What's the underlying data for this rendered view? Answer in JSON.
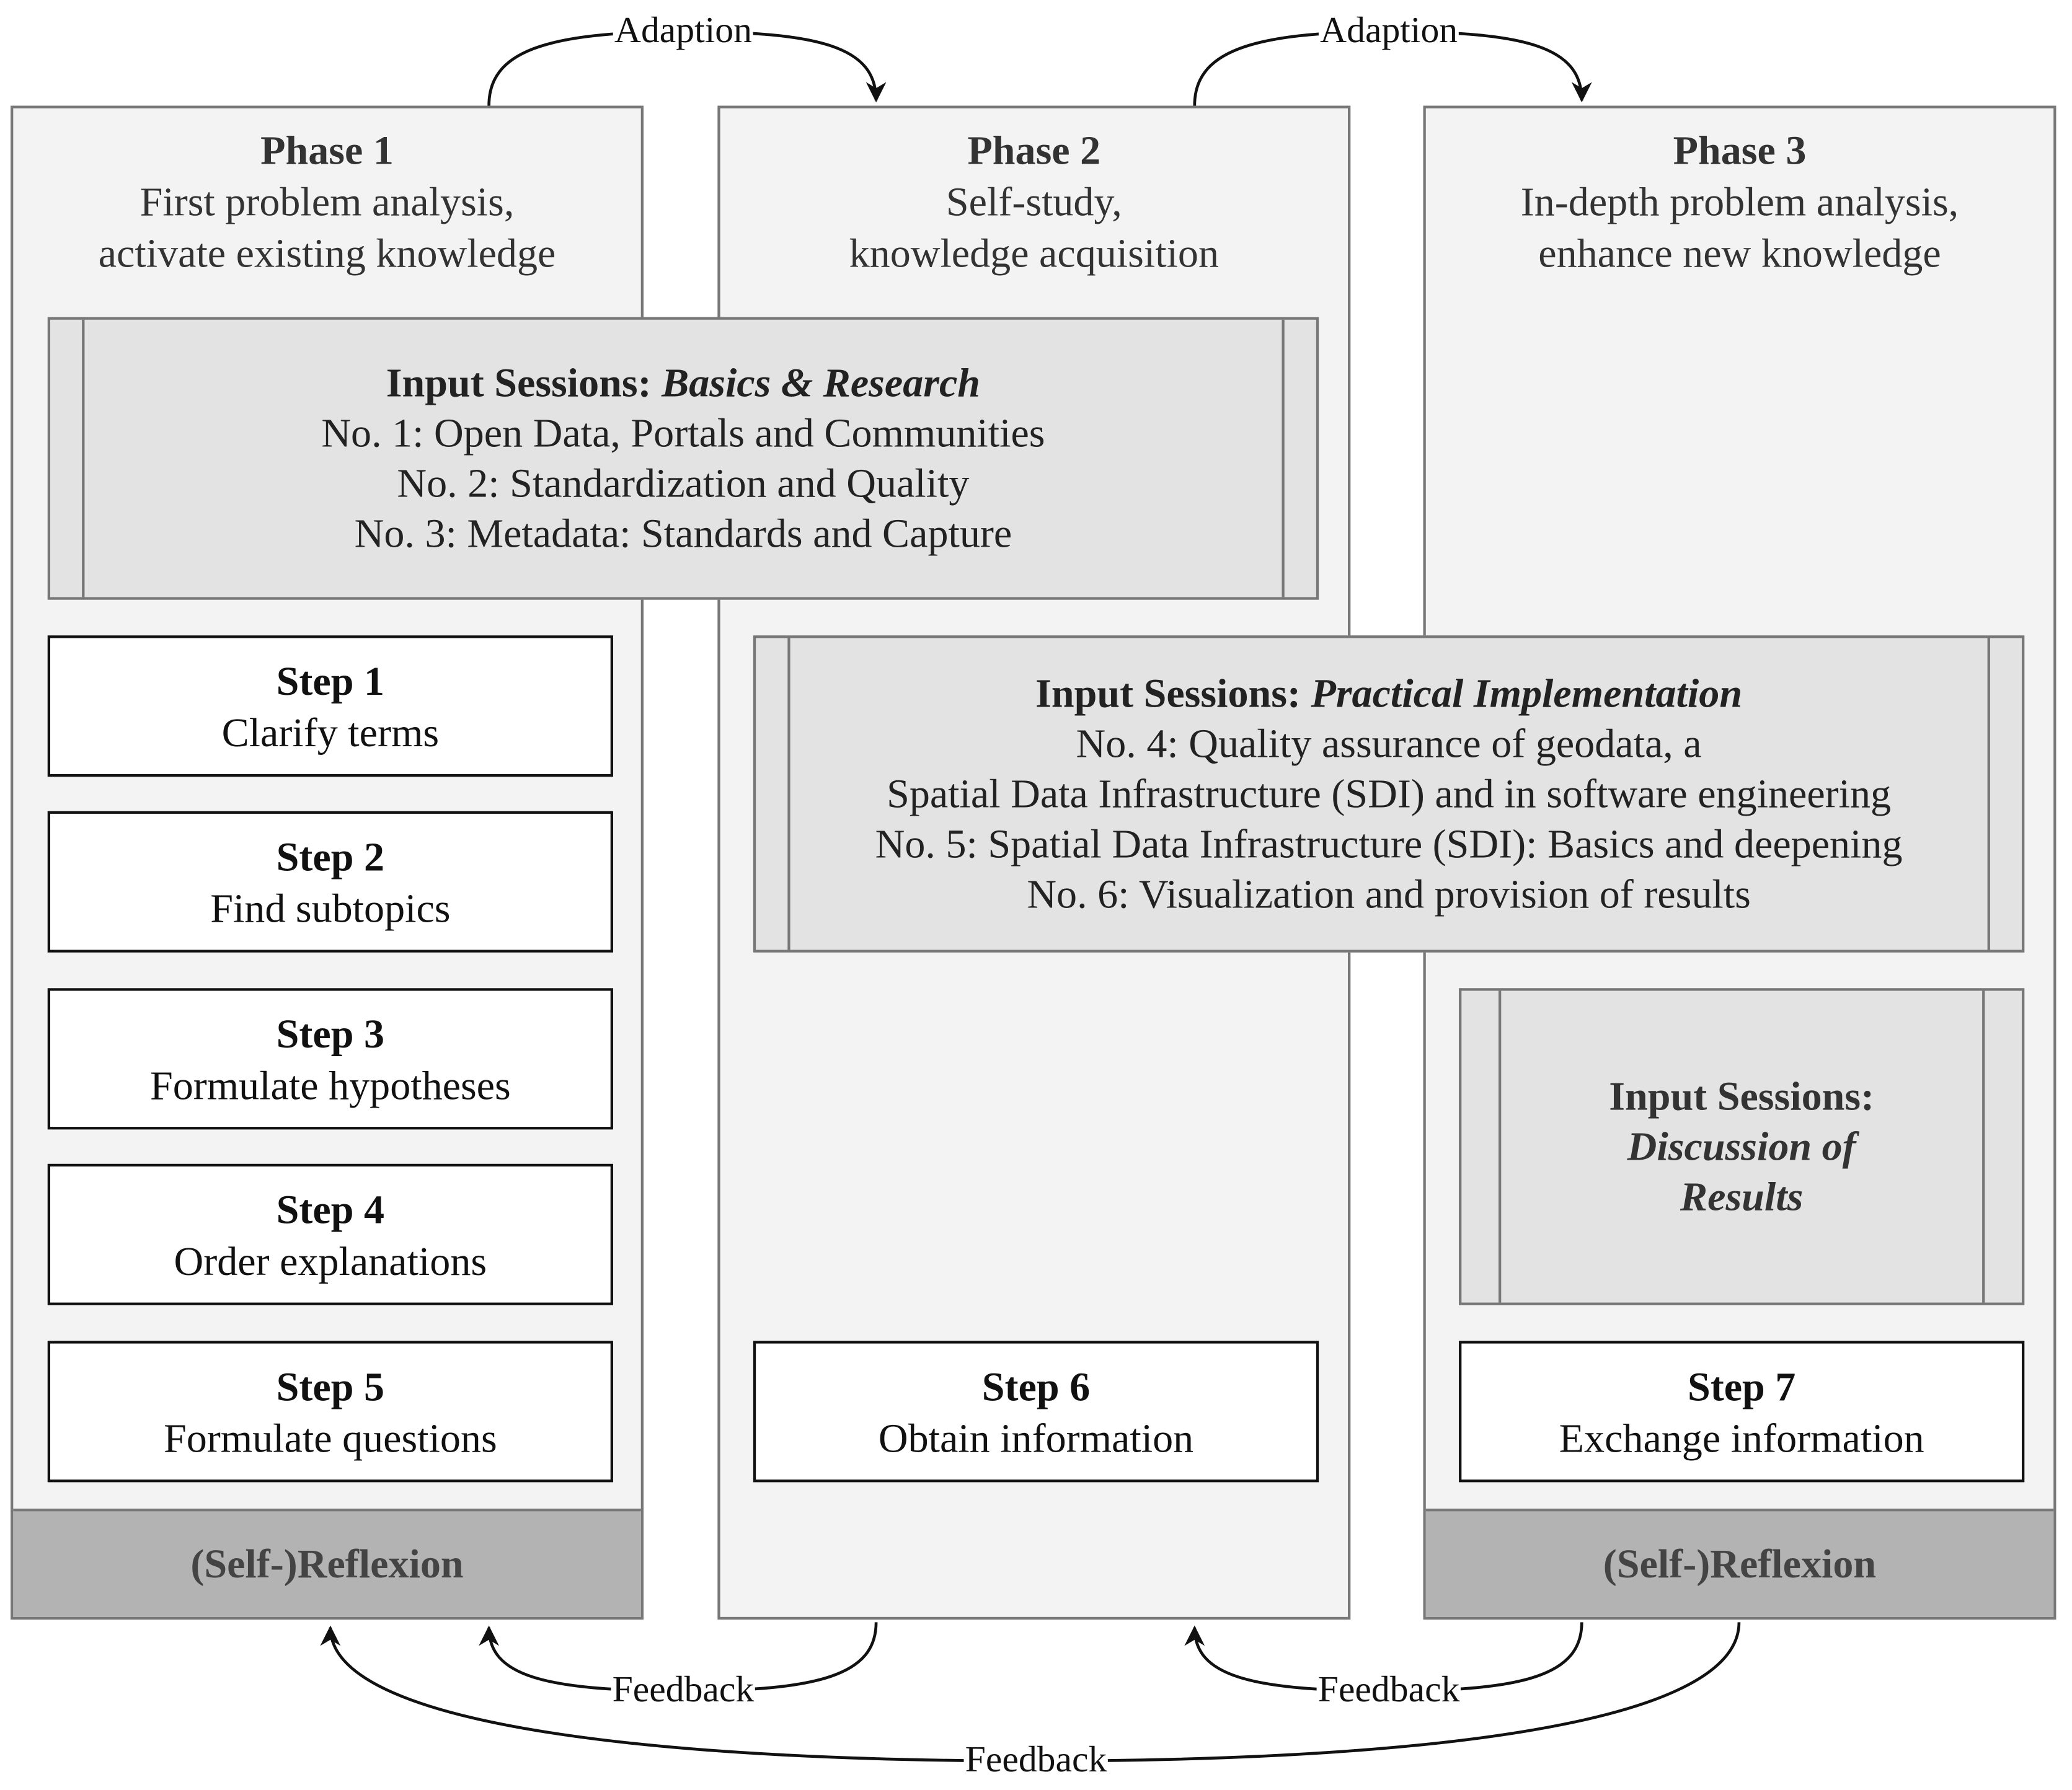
{
  "phases": [
    {
      "title": "Phase 1",
      "lines": [
        "First problem analysis,",
        "activate existing knowledge"
      ],
      "reflexion": "(Self-)Reflexion"
    },
    {
      "title": "Phase 2",
      "lines": [
        "Self-study,",
        "knowledge acquisition"
      ]
    },
    {
      "title": "Phase 3",
      "lines": [
        "In-depth problem analysis,",
        "enhance new knowledge"
      ],
      "reflexion": "(Self-)Reflexion"
    }
  ],
  "sessions": [
    {
      "prefix": "Input Sessions: ",
      "topic": "Basics & Research",
      "items": [
        "No. 1: Open Data, Portals and Communities",
        "No. 2: Standardization and Quality",
        "No. 3: Metadata: Standards and Capture"
      ]
    },
    {
      "prefix": "Input Sessions: ",
      "topic": "Practical Implementation",
      "items": [
        "No. 4: Quality assurance of geodata, a",
        "Spatial Data Infrastructure (SDI) and in software engineering",
        "No. 5: Spatial Data Infrastructure (SDI): Basics and deepening",
        "No. 6: Visualization and provision of results"
      ]
    },
    {
      "prefix": "Input Sessions:",
      "topic_lines": [
        "Discussion of",
        "Results"
      ]
    }
  ],
  "steps": [
    {
      "title": "Step 1",
      "text": "Clarify terms"
    },
    {
      "title": "Step 2",
      "text": "Find subtopics"
    },
    {
      "title": "Step 3",
      "text": "Formulate hypotheses"
    },
    {
      "title": "Step 4",
      "text": "Order explanations"
    },
    {
      "title": "Step 5",
      "text": "Formulate questions"
    },
    {
      "title": "Step 6",
      "text": "Obtain information"
    },
    {
      "title": "Step 7",
      "text": "Exchange information"
    }
  ],
  "arrows": {
    "adaption_1": "Adaption",
    "adaption_2": "Adaption",
    "feedback_1": "Feedback",
    "feedback_2": "Feedback",
    "feedback_3": "Feedback"
  },
  "colors": {
    "phase_bg": "#f3f3f3",
    "session_bg": "#e3e3e3",
    "reflexion_bg": "#b3b3b3",
    "border": "#777777"
  }
}
